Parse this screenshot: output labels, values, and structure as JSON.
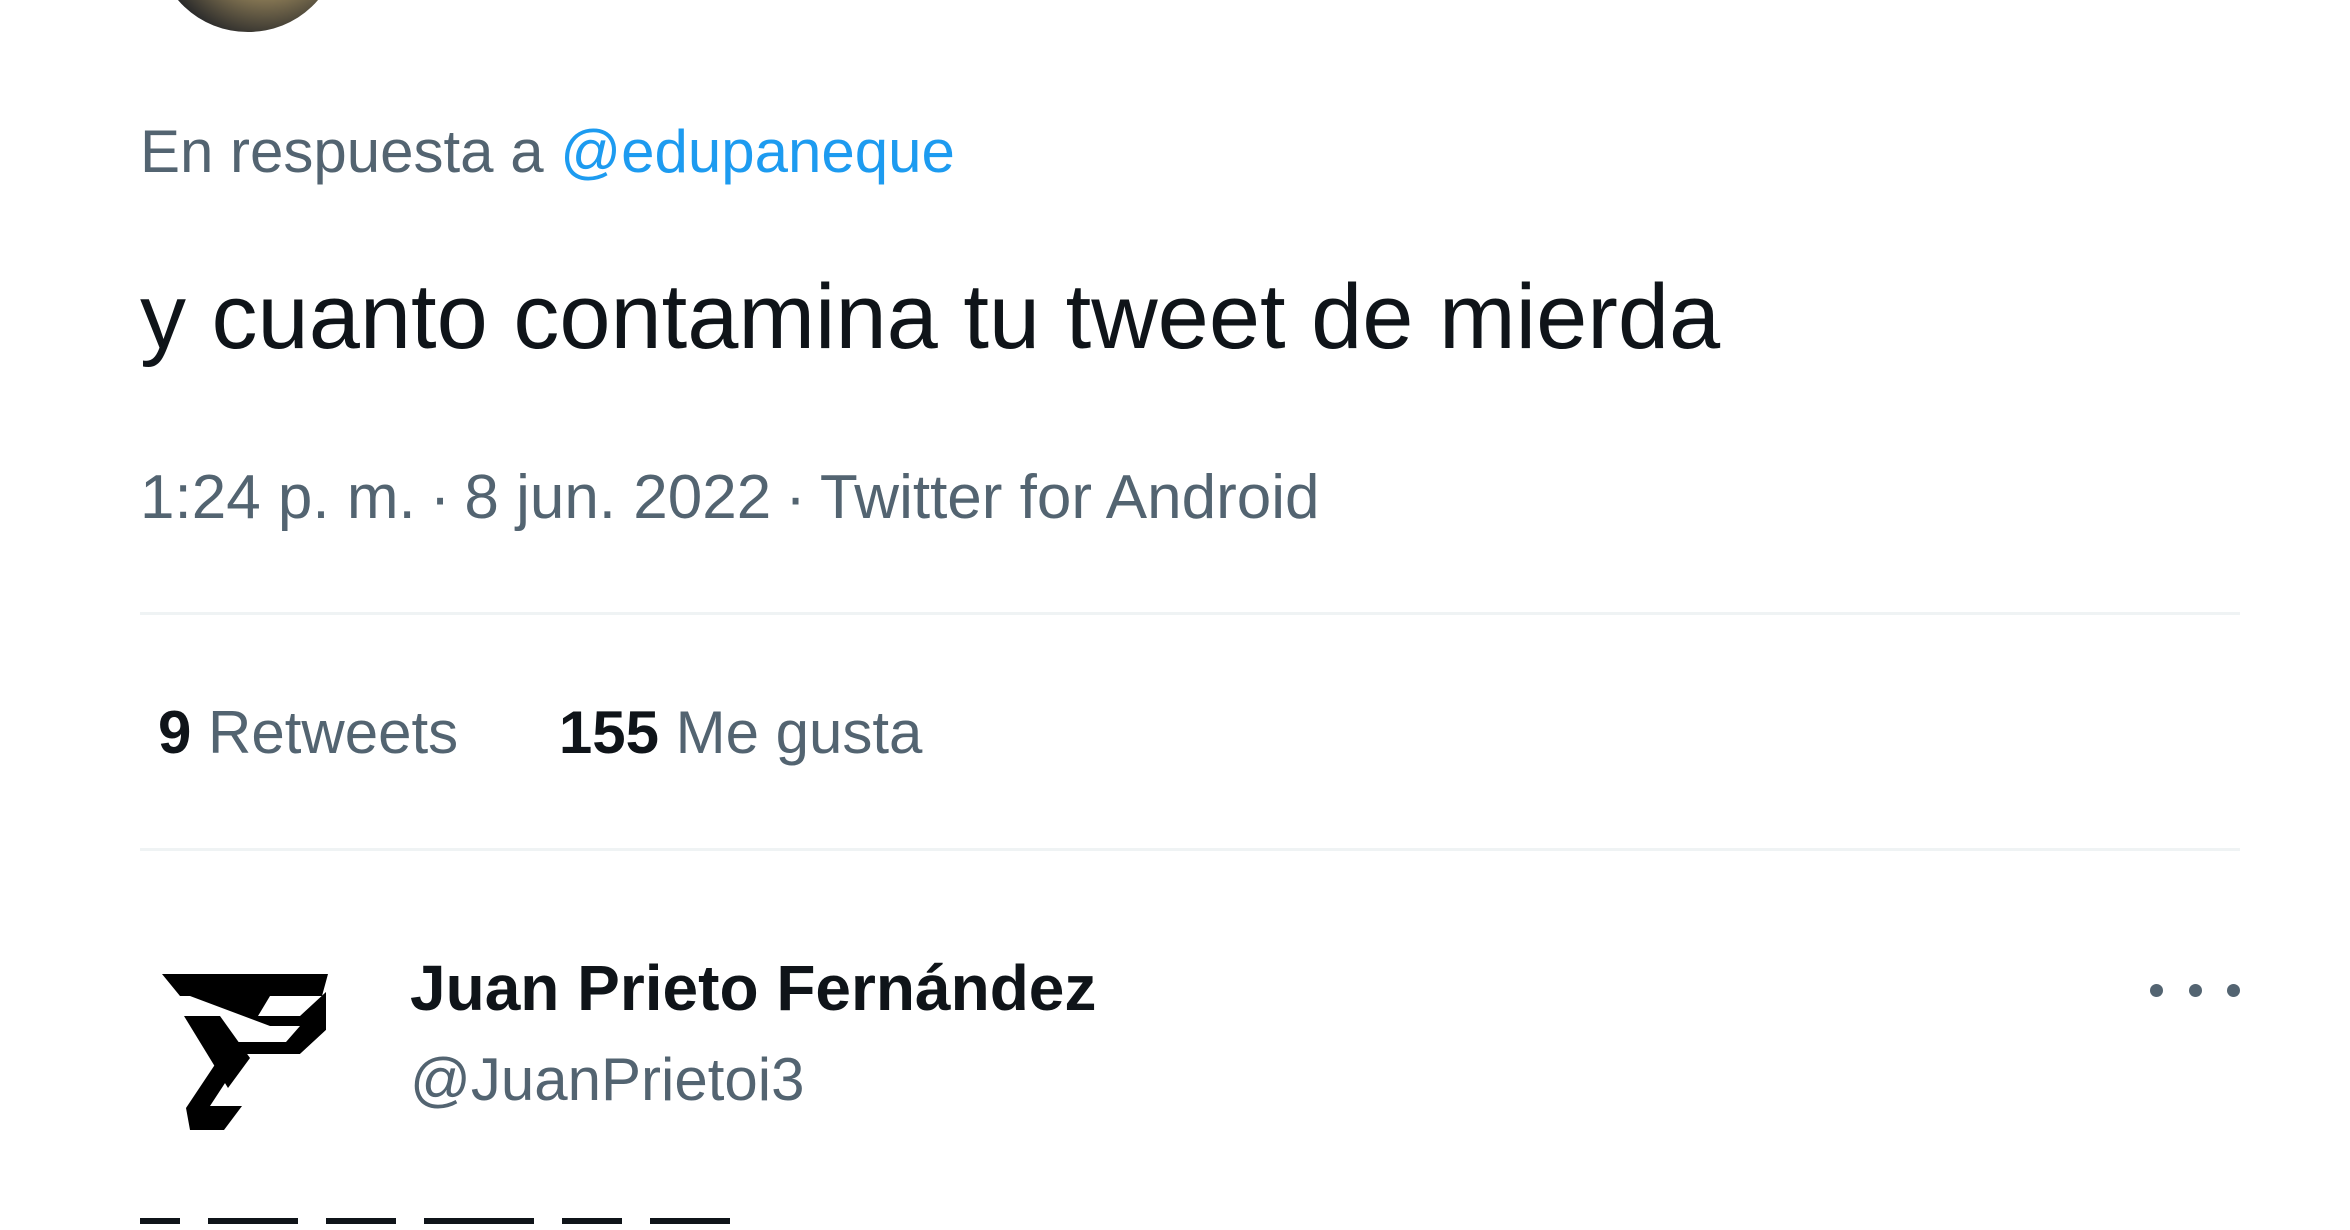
{
  "reply": {
    "prefix": "En respuesta a",
    "mention": "@edupaneque"
  },
  "tweet": {
    "text": "y cuanto contamina tu tweet de mierda",
    "time": "1:24 p. m.",
    "separator": "·",
    "date": "8 jun. 2022",
    "source": "Twitter for Android"
  },
  "stats": {
    "retweets_count": "9",
    "retweets_label": "Retweets",
    "likes_count": "155",
    "likes_label": "Me gusta"
  },
  "next_tweet": {
    "author_name": "Juan Prieto Fernández",
    "author_handle": "@JuanPrietoi3",
    "more_icon": "more-horizontal-icon",
    "avatar_icon": "jp-logo"
  },
  "colors": {
    "text_primary": "#0f1419",
    "text_secondary": "#536471",
    "link": "#1d9bf0",
    "divider": "#eff3f4"
  }
}
